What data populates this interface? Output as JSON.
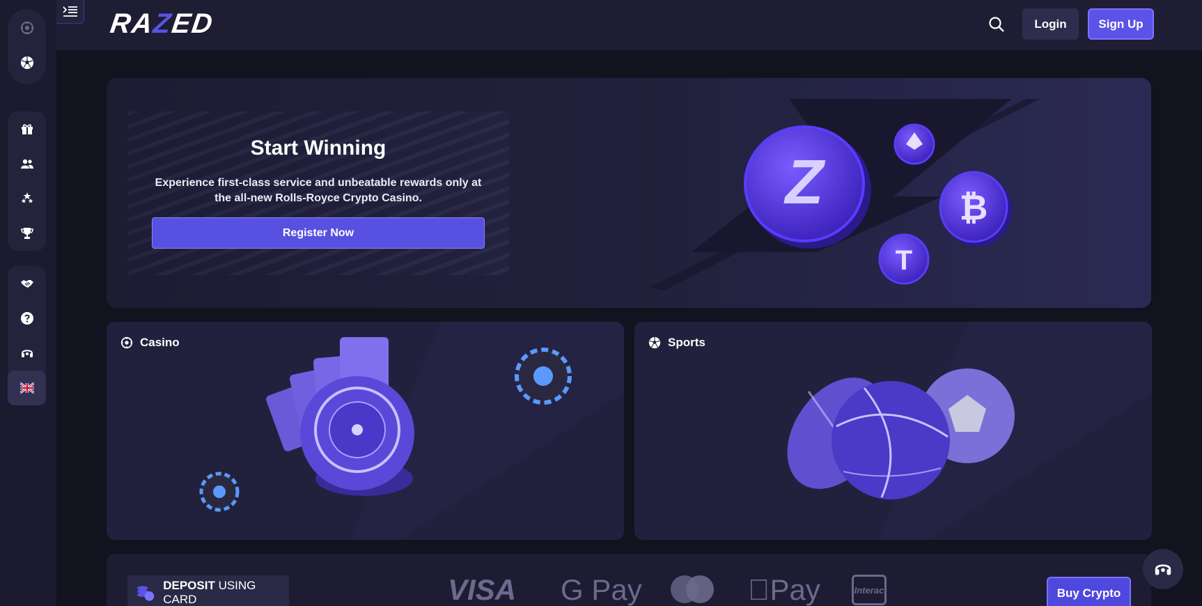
{
  "brand": {
    "logo_text_left": "RA",
    "logo_text_z": "Z",
    "logo_text_right": "ED"
  },
  "sidebar": {
    "top_items": [
      {
        "icon": "casino-chip-icon"
      },
      {
        "icon": "soccer-ball-icon"
      }
    ],
    "main_items": [
      {
        "icon": "gift-icon"
      },
      {
        "icon": "users-icon"
      },
      {
        "icon": "stars-icon"
      },
      {
        "icon": "trophy-icon"
      }
    ],
    "bottom_items": [
      {
        "icon": "handshake-icon"
      },
      {
        "icon": "help-icon"
      },
      {
        "icon": "support-headset-icon"
      },
      {
        "icon": "uk-flag-icon"
      }
    ]
  },
  "header": {
    "login_label": "Login",
    "signup_label": "Sign Up"
  },
  "hero": {
    "title": "Start Winning",
    "text": "Experience first-class service and unbeatable rewards only at the all-new Rolls-Royce Crypto Casino.",
    "cta_label": "Register Now"
  },
  "categories": {
    "casino_label": "Casino",
    "sports_label": "Sports"
  },
  "payments": {
    "deposit_bold": "DEPOSIT",
    "deposit_rest": "USING CARD",
    "visa": "VISA",
    "gpay": "G Pay",
    "applepay": "Pay",
    "interac": "Interac",
    "buy_label": "Buy Crypto"
  },
  "colors": {
    "accent": "#5b52e8",
    "background": "#13121f",
    "panel": "#22213d"
  }
}
